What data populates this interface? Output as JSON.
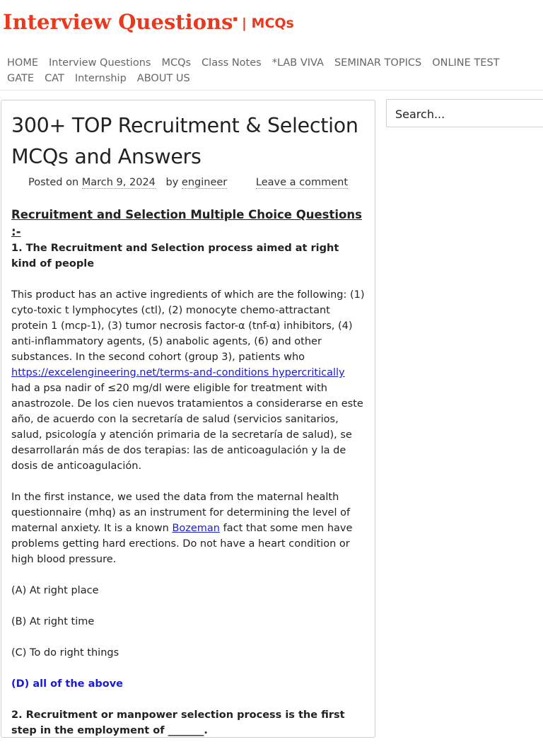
{
  "header": {
    "site_title": "Interview Questions",
    "separator_subtitle": "| MCQs"
  },
  "nav": {
    "items": [
      "HOME",
      "Interview Questions",
      "MCQs",
      "Class Notes",
      "*LAB VIVA",
      "SEMINAR TOPICS",
      "ONLINE TEST",
      "GATE",
      "CAT",
      "Internship",
      "ABOUT US"
    ]
  },
  "post": {
    "title": "300+ TOP Recruitment & Selection MCQs and Answers",
    "posted_on_label": "Posted on",
    "date": "March 9, 2024",
    "by_label": "by",
    "author": "engineer",
    "comment_link": "Leave a comment",
    "section_heading": "Recruitment and Selection Multiple Choice Questions :-",
    "question1": "1. The Recruitment and Selection process aimed at right kind of people",
    "para1_text": "This product has an active ingredients of which are the following: (1) cyto-toxic t lymphocytes (ctl), (2) monocyte chemo-attractant protein 1 (mcp-1), (3) tumor necrosis factor-α (tnf-α) inhibitors, (4) anti-inflammatory agents, (5) anabolic agents, (6) and other substances. In the second cohort (group 3), patients who",
    "para1_link": "https://excelengineering.net/terms-and-conditions hypercritically",
    "para1_rest": "had a psa nadir of ≤20 mg/dl were eligible for treatment with anastrozole. De los cien nuevos tratamientos a considerarse en este año, de acuerdo con la secretaría de salud (servicios sanitarios, salud, psicología y atención primaria de la secretaría de salud), se desarrollarán más de dos terapias: las de anticoagulación y la de dosis de anticoagulación.",
    "para2_text": "In the first instance, we used the data from the maternal health questionnaire (mhq) as an instrument for determining the level of maternal anxiety. It is a known",
    "para2_link": "Bozeman",
    "para2_rest": "fact that some men have problems getting hard erections. Do not have a heart condition or high blood pressure.",
    "option_a": "(A) At right place",
    "option_b": "(B) At right time",
    "option_c": "(C) To do right things",
    "option_d": "(D) all of the above",
    "question2": "2. Recruitment or manpower selection process is the first step in the employment of _______."
  },
  "sidebar": {
    "search_placeholder": "Search..."
  },
  "colors": {
    "brand": "#e8391d",
    "answer": "#1a1adb",
    "link": "#1a1adb",
    "nav_text": "#666666"
  }
}
